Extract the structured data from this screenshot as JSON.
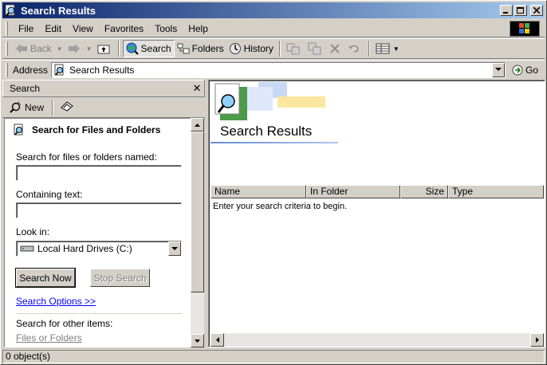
{
  "window": {
    "title": "Search Results"
  },
  "menu": [
    {
      "label": "File"
    },
    {
      "label": "Edit"
    },
    {
      "label": "View"
    },
    {
      "label": "Favorites"
    },
    {
      "label": "Tools"
    },
    {
      "label": "Help"
    }
  ],
  "toolbar": {
    "back_label": "Back",
    "search_label": "Search",
    "folders_label": "Folders",
    "history_label": "History"
  },
  "address": {
    "label": "Address",
    "value": "Search Results",
    "go_label": "Go"
  },
  "search_pane": {
    "header": "Search",
    "new_label": "New",
    "heading": "Search for Files and Folders",
    "named_label": "Search for files or folders named:",
    "named_value": "",
    "containing_label": "Containing text:",
    "containing_value": "",
    "look_in_label": "Look in:",
    "look_in_value": "Local Hard Drives (C:)",
    "search_now": "Search Now",
    "stop_search": "Stop Search",
    "options_link": "Search Options >>",
    "other_items_label": "Search for other items:",
    "files_or_folders_link": "Files or Folders"
  },
  "results": {
    "title": "Search Results",
    "columns": [
      "Name",
      "In Folder",
      "Size",
      "Type"
    ],
    "hint": "Enter your search criteria to begin."
  },
  "status": {
    "text": "0 object(s)"
  }
}
